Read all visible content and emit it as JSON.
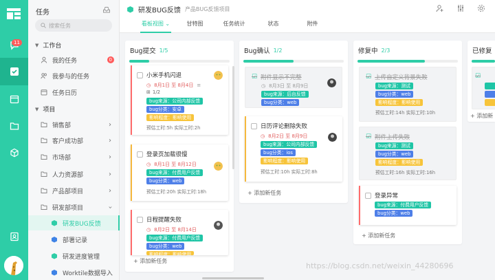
{
  "rail": {
    "notification_count": "11"
  },
  "sidebar": {
    "title": "任务",
    "search_placeholder": "搜索任务",
    "workbench_label": "工作台",
    "workbench_items": [
      {
        "label": "我的任务",
        "count": "0"
      },
      {
        "label": "我参与的任务"
      },
      {
        "label": "任务日历"
      }
    ],
    "projects_label": "项目",
    "project_items": [
      {
        "label": "销售部"
      },
      {
        "label": "客户成功部"
      },
      {
        "label": "市场部"
      },
      {
        "label": "人力资源部"
      },
      {
        "label": "产品部项目"
      },
      {
        "label": "研发部项目"
      }
    ],
    "sub_items": [
      {
        "label": "研发BUG反馈"
      },
      {
        "label": "部署记录"
      },
      {
        "label": "研发进度管理"
      },
      {
        "label": "Worktile数据导入"
      }
    ]
  },
  "header": {
    "project_title": "研发BUG反馈",
    "project_subtitle": "产品BUG反馈项目",
    "tabs": [
      "看板视图",
      "甘特图",
      "任务统计",
      "状态",
      "附件"
    ]
  },
  "columns": [
    {
      "name": "Bug提交",
      "count": "1/5",
      "progress": 0.2,
      "add_label": "添加新任务",
      "cards": [
        {
          "title": "小米手机闪退",
          "date": "8月1日 至 8月4日",
          "subtasks": "1/2",
          "tags": [
            "bug来源：公司内部反馈",
            "bug分类：安卓",
            "影响程度：影响使用"
          ],
          "work": "预估工时:5h  实际工时:2h",
          "accent": "#ff6b6b"
        },
        {
          "title": "登录页加载很慢",
          "date": "8月1日 至 8月12日",
          "tags": [
            "bug来源：付费用户反馈",
            "bug分类：web"
          ],
          "work": "预估工时:20h  实际工时:18h",
          "accent": "#f5b83d"
        },
        {
          "title": "日程提醒失败",
          "date": "8月2日 至 8月14日",
          "tags": [
            "bug来源：付费用户反馈",
            "bug分类：web",
            "影响程度：影响使用"
          ],
          "work": "",
          "accent": "#ff6b6b"
        }
      ]
    },
    {
      "name": "Bug确认",
      "count": "1/2",
      "progress": 0.5,
      "add_label": "添加新任务",
      "cards": [
        {
          "title": "附件显示不完整",
          "date": "8月3日 至 8月9日",
          "tags": [
            "bug来源：后台反馈",
            "bug分类：web"
          ],
          "work": "",
          "done": true
        },
        {
          "title": "日历评论删除失败",
          "date": "8月2日 至 8月9日",
          "tags": [
            "bug来源：公司内部反馈",
            "bug分类：ios",
            "影响程度：影响使用"
          ],
          "work": "预估工时:10h  实际工时:8h",
          "accent": "#f5b83d"
        }
      ]
    },
    {
      "name": "修复中",
      "count": "2/3",
      "progress": 0.67,
      "add_label": "添加新任务",
      "cards": [
        {
          "title": "上传自定义背景失败",
          "tags": [
            "bug来源：测试",
            "bug分类：web",
            "影响程度：影响使用"
          ],
          "work": "预估工时:14h  实际工时:10h",
          "done": true
        },
        {
          "title": "附件上传失败",
          "tags": [
            "bug来源：测试",
            "bug分类：web",
            "影响程度：影响使用"
          ],
          "work": "预估工时:16h  实际工时:16h",
          "done": true
        },
        {
          "title": "登录异常",
          "tags": [
            "bug来源：付费用户反馈",
            "bug分类：web"
          ],
          "work": "",
          "accent": "#ff6b6b"
        }
      ]
    },
    {
      "name": "已修复",
      "count": "",
      "progress": 1.0,
      "add_label": "添加新",
      "cards": []
    }
  ],
  "watermark": "https://blog.csdn.net/weixin_44280696",
  "colors": {
    "accent": "#2ecda7",
    "danger": "#ff5b5b"
  }
}
